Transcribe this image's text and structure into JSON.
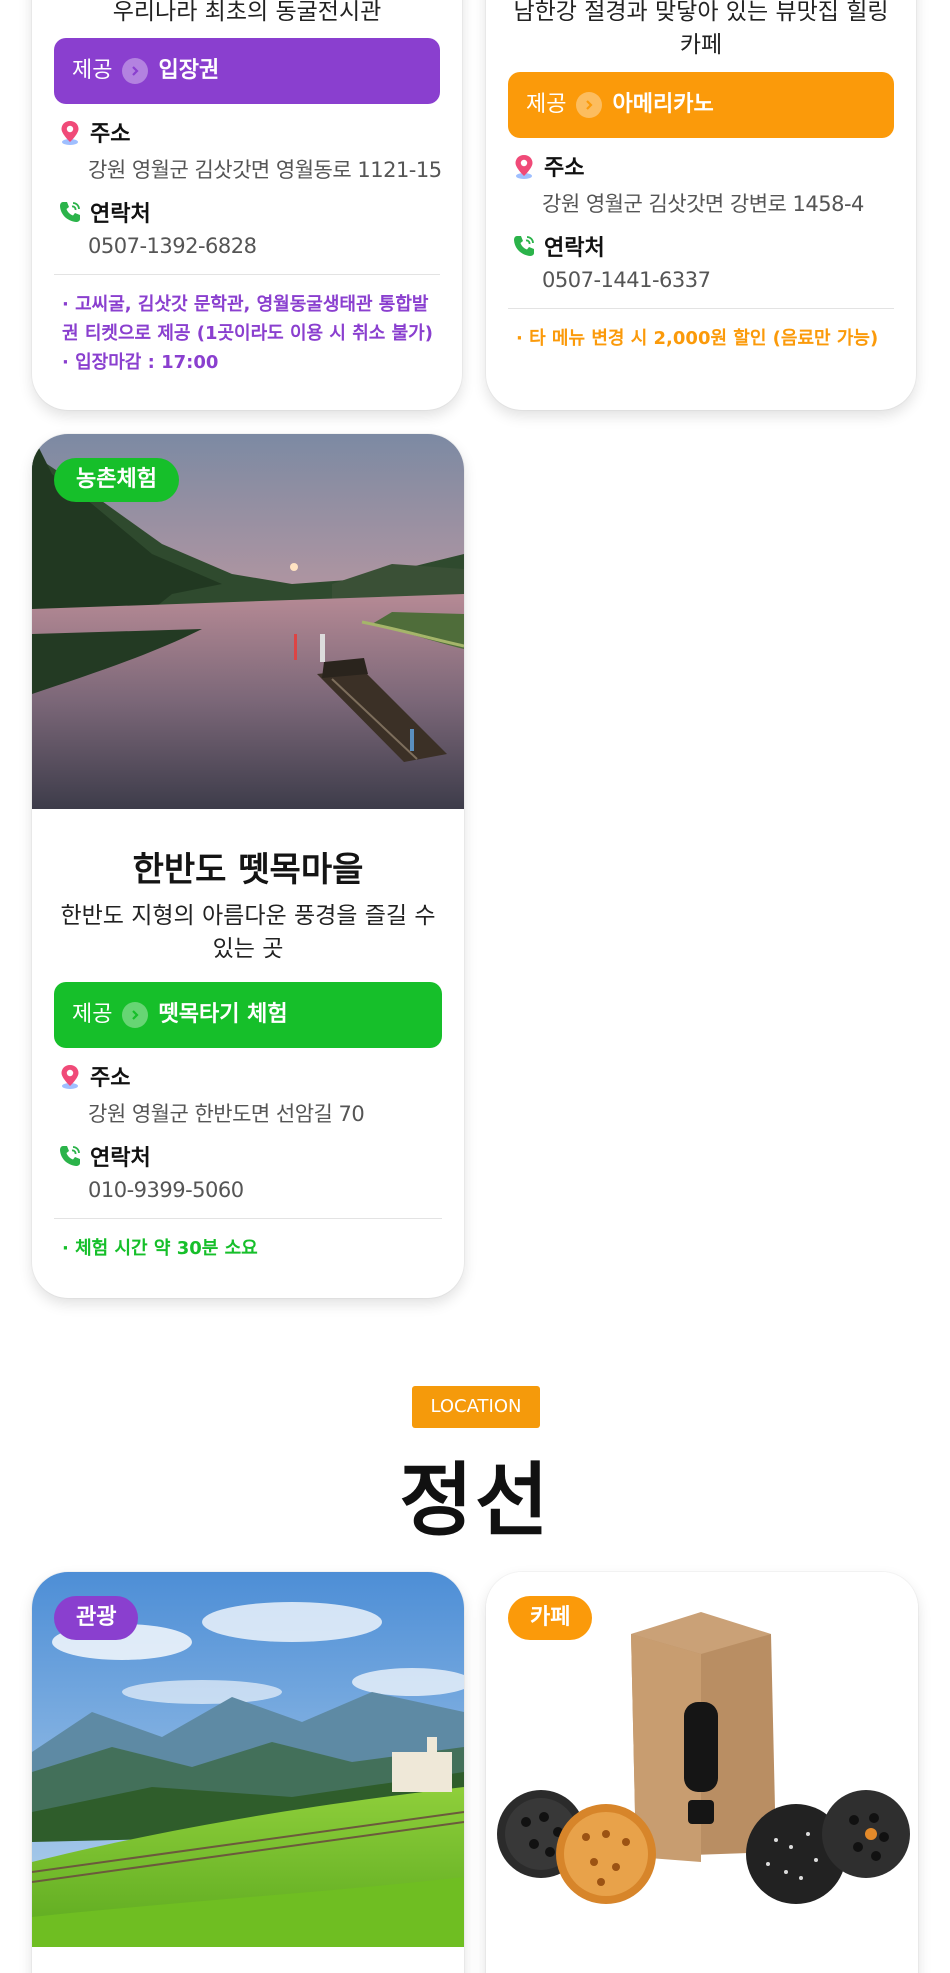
{
  "cards": {
    "cave": {
      "desc": "우리나라 최초의 동굴전시관",
      "provide_prefix": "제공",
      "provide_item": "입장권",
      "address_label": "주소",
      "address": "강원 영월군 김삿갓면 영월동로 1121-15",
      "contact_label": "연락처",
      "phone": "0507-1392-6828",
      "notes": [
        "· 고씨굴, 김삿갓 문학관, 영월동굴생태관 통합발권 티켓으로 제공 (1곳이라도 이용 시 취소 불가)",
        "· 입장마감 : 17:00"
      ],
      "accent": "#8a3fcf"
    },
    "cafe1": {
      "desc": "남한강 절경과 맞닿아 있는 뷰맛집 힐링 카페",
      "provide_prefix": "제공",
      "provide_item": "아메리카노",
      "address_label": "주소",
      "address": "강원 영월군 김삿갓면 강변로 1458-4",
      "contact_label": "연락처",
      "phone": "0507-1441-6337",
      "notes": [
        "· 타 메뉴 변경 시 2,000원 할인 (음료만 가능)"
      ],
      "accent": "#fb9a0a"
    },
    "village": {
      "badge": "농촌체험",
      "title": "한반도 뗏목마을",
      "desc": "한반도 지형의 아름다운 풍경을 즐길 수 있는 곳",
      "provide_prefix": "제공",
      "provide_item": "뗏목타기 체험",
      "address_label": "주소",
      "address": "강원 영월군 한반도면 선암길 70",
      "contact_label": "연락처",
      "phone": "010-9399-5060",
      "notes": [
        "· 체험 시간 약 30분 소요"
      ],
      "accent": "#16bf2a"
    },
    "tour": {
      "badge": "관광",
      "accent": "#8a3fcf"
    },
    "cafe2": {
      "badge": "카페",
      "accent": "#fb9a0a"
    }
  },
  "location": {
    "tag": "LOCATION",
    "title": "정선"
  },
  "icons": [
    "pin-icon",
    "phone-icon",
    "chevron-right-icon"
  ]
}
